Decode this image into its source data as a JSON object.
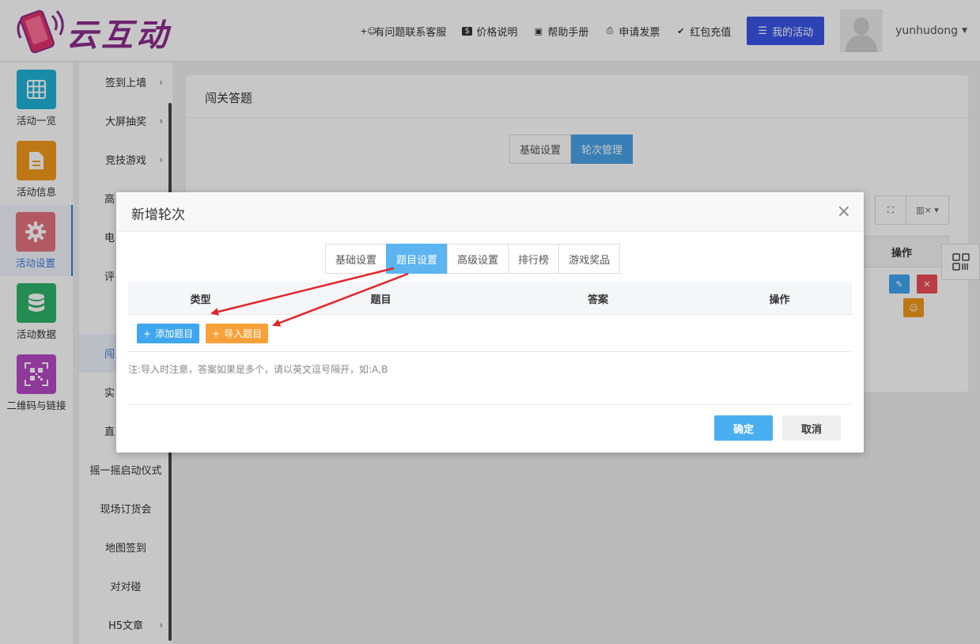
{
  "header": {
    "logo_text": "云互动",
    "nav": [
      {
        "label": "有问题联系客服",
        "icon": "add-user-icon"
      },
      {
        "label": "价格说明",
        "icon": "dollar-icon"
      },
      {
        "label": "帮助手册",
        "icon": "book-icon"
      },
      {
        "label": "申请发票",
        "icon": "printer-icon"
      },
      {
        "label": "红包充值",
        "icon": "shield-check-icon"
      }
    ],
    "my_activity": "我的活动",
    "username": "yunhudong"
  },
  "iconbar": [
    {
      "label": "活动一览",
      "color": "#1fb2d8",
      "icon": "grid-icon"
    },
    {
      "label": "活动信息",
      "color": "#f39a1c",
      "icon": "document-icon"
    },
    {
      "label": "活动设置",
      "color": "#e6737f",
      "icon": "gear-icon",
      "active": true
    },
    {
      "label": "活动数据",
      "color": "#2fb36a",
      "icon": "database-icon"
    },
    {
      "label": "二维码与链接",
      "color": "#b849c7",
      "icon": "qrcode-icon"
    }
  ],
  "submenu": [
    {
      "label": "签到上墙",
      "arrow": "›"
    },
    {
      "label": "大屏抽奖",
      "arrow": "›"
    },
    {
      "label": "竞技游戏",
      "arrow": "›"
    },
    {
      "label": "高",
      "arrow": ""
    },
    {
      "label": "电",
      "arrow": ""
    },
    {
      "label": "评",
      "arrow": ""
    },
    {
      "label": "",
      "arrow": ""
    },
    {
      "label": "闯",
      "arrow": "",
      "active": true
    },
    {
      "label": "实",
      "arrow": ""
    },
    {
      "label": "直",
      "arrow": ""
    },
    {
      "label": "摇一摇启动仪式",
      "arrow": ""
    },
    {
      "label": "现场订货会",
      "arrow": ""
    },
    {
      "label": "地图签到",
      "arrow": ""
    },
    {
      "label": "对对碰",
      "arrow": ""
    },
    {
      "label": "H5文章",
      "arrow": "›"
    }
  ],
  "panel": {
    "title": "闯关答题",
    "tabs": [
      "基础设置",
      "轮次管理"
    ],
    "table_head_op": "操作"
  },
  "modal": {
    "title": "新增轮次",
    "close": "×",
    "tabs": [
      "基础设置",
      "题目设置",
      "高级设置",
      "排行榜",
      "游戏奖品"
    ],
    "active_tab": 1,
    "columns": [
      "类型",
      "题目",
      "答案",
      "操作"
    ],
    "add_button": "添加题目",
    "import_button": "导入题目",
    "note": "注:导入时注意，答案如果是多个，请以英文逗号隔开，如:A,B",
    "ok": "确定",
    "cancel": "取消"
  },
  "colors": {
    "primary": "#3a57e8",
    "tab_active": "#5cb4f0",
    "add": "#3fa6f0",
    "import": "#f8a13a",
    "arrow": "#e0262b"
  }
}
